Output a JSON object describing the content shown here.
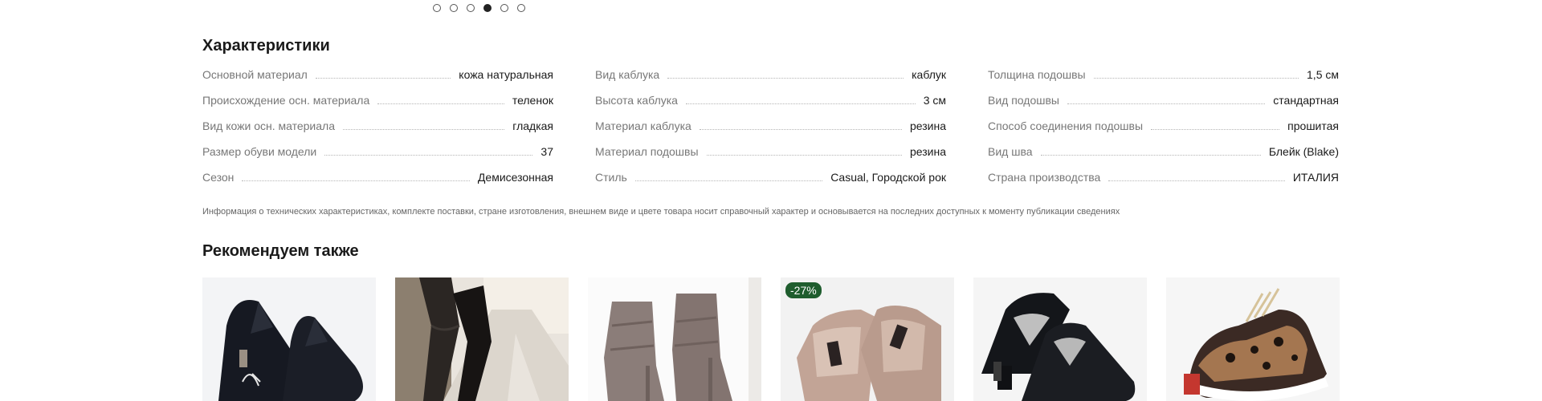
{
  "carousel": {
    "total_slides": 6,
    "active_index": 3
  },
  "specs": {
    "title": "Характеристики",
    "columns": [
      [
        {
          "label": "Основной материал",
          "value": "кожа натуральная"
        },
        {
          "label": "Происхождение осн. материала",
          "value": "теленок"
        },
        {
          "label": "Вид кожи осн. материала",
          "value": "гладкая"
        },
        {
          "label": "Размер обуви модели",
          "value": "37"
        },
        {
          "label": "Сезон",
          "value": "Демисезонная"
        }
      ],
      [
        {
          "label": "Вид каблука",
          "value": "каблук"
        },
        {
          "label": "Высота каблука",
          "value": "3 см"
        },
        {
          "label": "Материал каблука",
          "value": "резина"
        },
        {
          "label": "Материал подошвы",
          "value": "резина"
        },
        {
          "label": "Стиль",
          "value": "Casual, Городской рок"
        }
      ],
      [
        {
          "label": "Толщина подошвы",
          "value": "1,5 см"
        },
        {
          "label": "Вид подошвы",
          "value": "стандартная"
        },
        {
          "label": "Способ соединения подошвы",
          "value": "прошитая"
        },
        {
          "label": "Вид шва",
          "value": "Блейк (Blake)"
        },
        {
          "label": "Страна производства",
          "value": "ИТАЛИЯ"
        }
      ]
    ],
    "disclaimer": "Информация о технических характеристиках, комплекте поставки, стране изготовления, внешнем виде и цвете товара носит справочный характер и основывается на последних доступных к моменту публикации сведениях"
  },
  "recommended": {
    "title": "Рекомендуем также",
    "products": [
      {
        "image": "black-suede-pointed-shoe",
        "badge": ""
      },
      {
        "image": "black-leather-tall-boots",
        "badge": ""
      },
      {
        "image": "taupe-suede-ankle-boots",
        "badge": ""
      },
      {
        "image": "beige-leather-pumps",
        "badge": "-27%"
      },
      {
        "image": "black-leather-loafer-heels",
        "badge": ""
      },
      {
        "image": "leopard-print-sneakers",
        "badge": ""
      }
    ]
  },
  "colors": {
    "badge_bg": "#1f5d2e",
    "dot_active": "#222222"
  }
}
